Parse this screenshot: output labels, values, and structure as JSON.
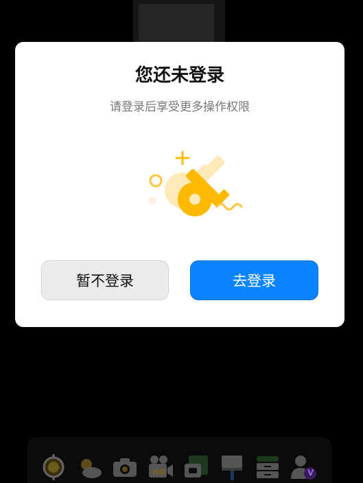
{
  "dialog": {
    "title": "您还未登录",
    "subtitle": "请登录后享受更多操作权限",
    "cancel_label": "暂不登录",
    "login_label": "去登录"
  },
  "colors": {
    "primary": "#0a84ff",
    "key": "#ffba00",
    "key_light": "#ffe6a6",
    "overlay": "#000000"
  },
  "dock": {
    "items": [
      {
        "icon": "target-icon"
      },
      {
        "icon": "weather-icon"
      },
      {
        "icon": "camera-icon"
      },
      {
        "icon": "hd-video-camera-icon"
      },
      {
        "icon": "gallery-icon"
      },
      {
        "icon": "brush-icon"
      },
      {
        "icon": "storage-icon"
      },
      {
        "icon": "vip-user-icon"
      }
    ],
    "hd_label": "HD",
    "vip_label": "V"
  }
}
